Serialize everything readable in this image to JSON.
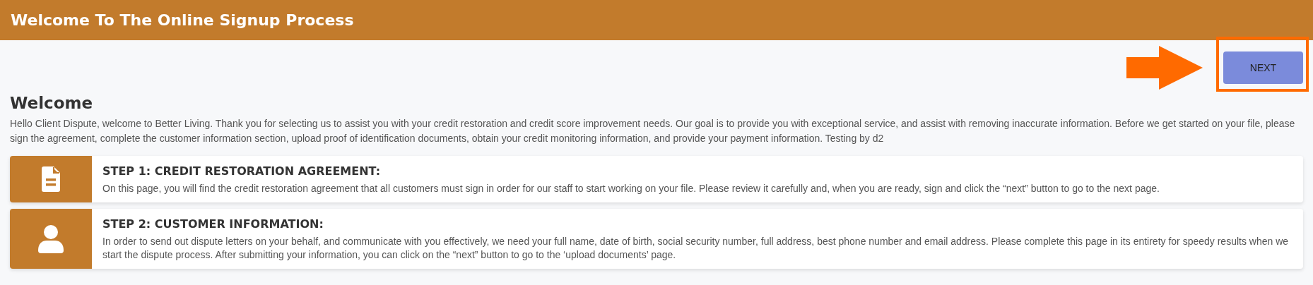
{
  "header": {
    "title": "Welcome To The Online Signup Process"
  },
  "next_button": {
    "label": "NEXT"
  },
  "welcome": {
    "heading": "Welcome",
    "text": "Hello Client Dispute, welcome to Better Living. Thank you for selecting us to assist you with your credit restoration and credit score improvement needs. Our goal is to provide you with exceptional service, and assist with removing inaccurate information. Before we get started on your file, please sign the agreement, complete the customer information section, upload proof of identification documents, obtain your credit monitoring information, and provide your payment information. Testing by d2"
  },
  "steps": [
    {
      "kind": "document",
      "title": "STEP 1: CREDIT RESTORATION AGREEMENT:",
      "text": "On this page, you will find the credit restoration agreement that all customers must sign in order for our staff to start working on your file. Please review it carefully and, when you are ready, sign and click the “next” button to go to the next page."
    },
    {
      "kind": "person",
      "title": "STEP 2: CUSTOMER INFORMATION:",
      "text": "In order to send out dispute letters on your behalf, and communicate with you effectively, we need your full name, date of birth, social security number, full address, best phone number and email address. Please complete this page in its entirety for speedy results when we start the dispute process. After submitting your information, you can click on the “next” button to go to the ‘upload documents’ page."
    }
  ]
}
